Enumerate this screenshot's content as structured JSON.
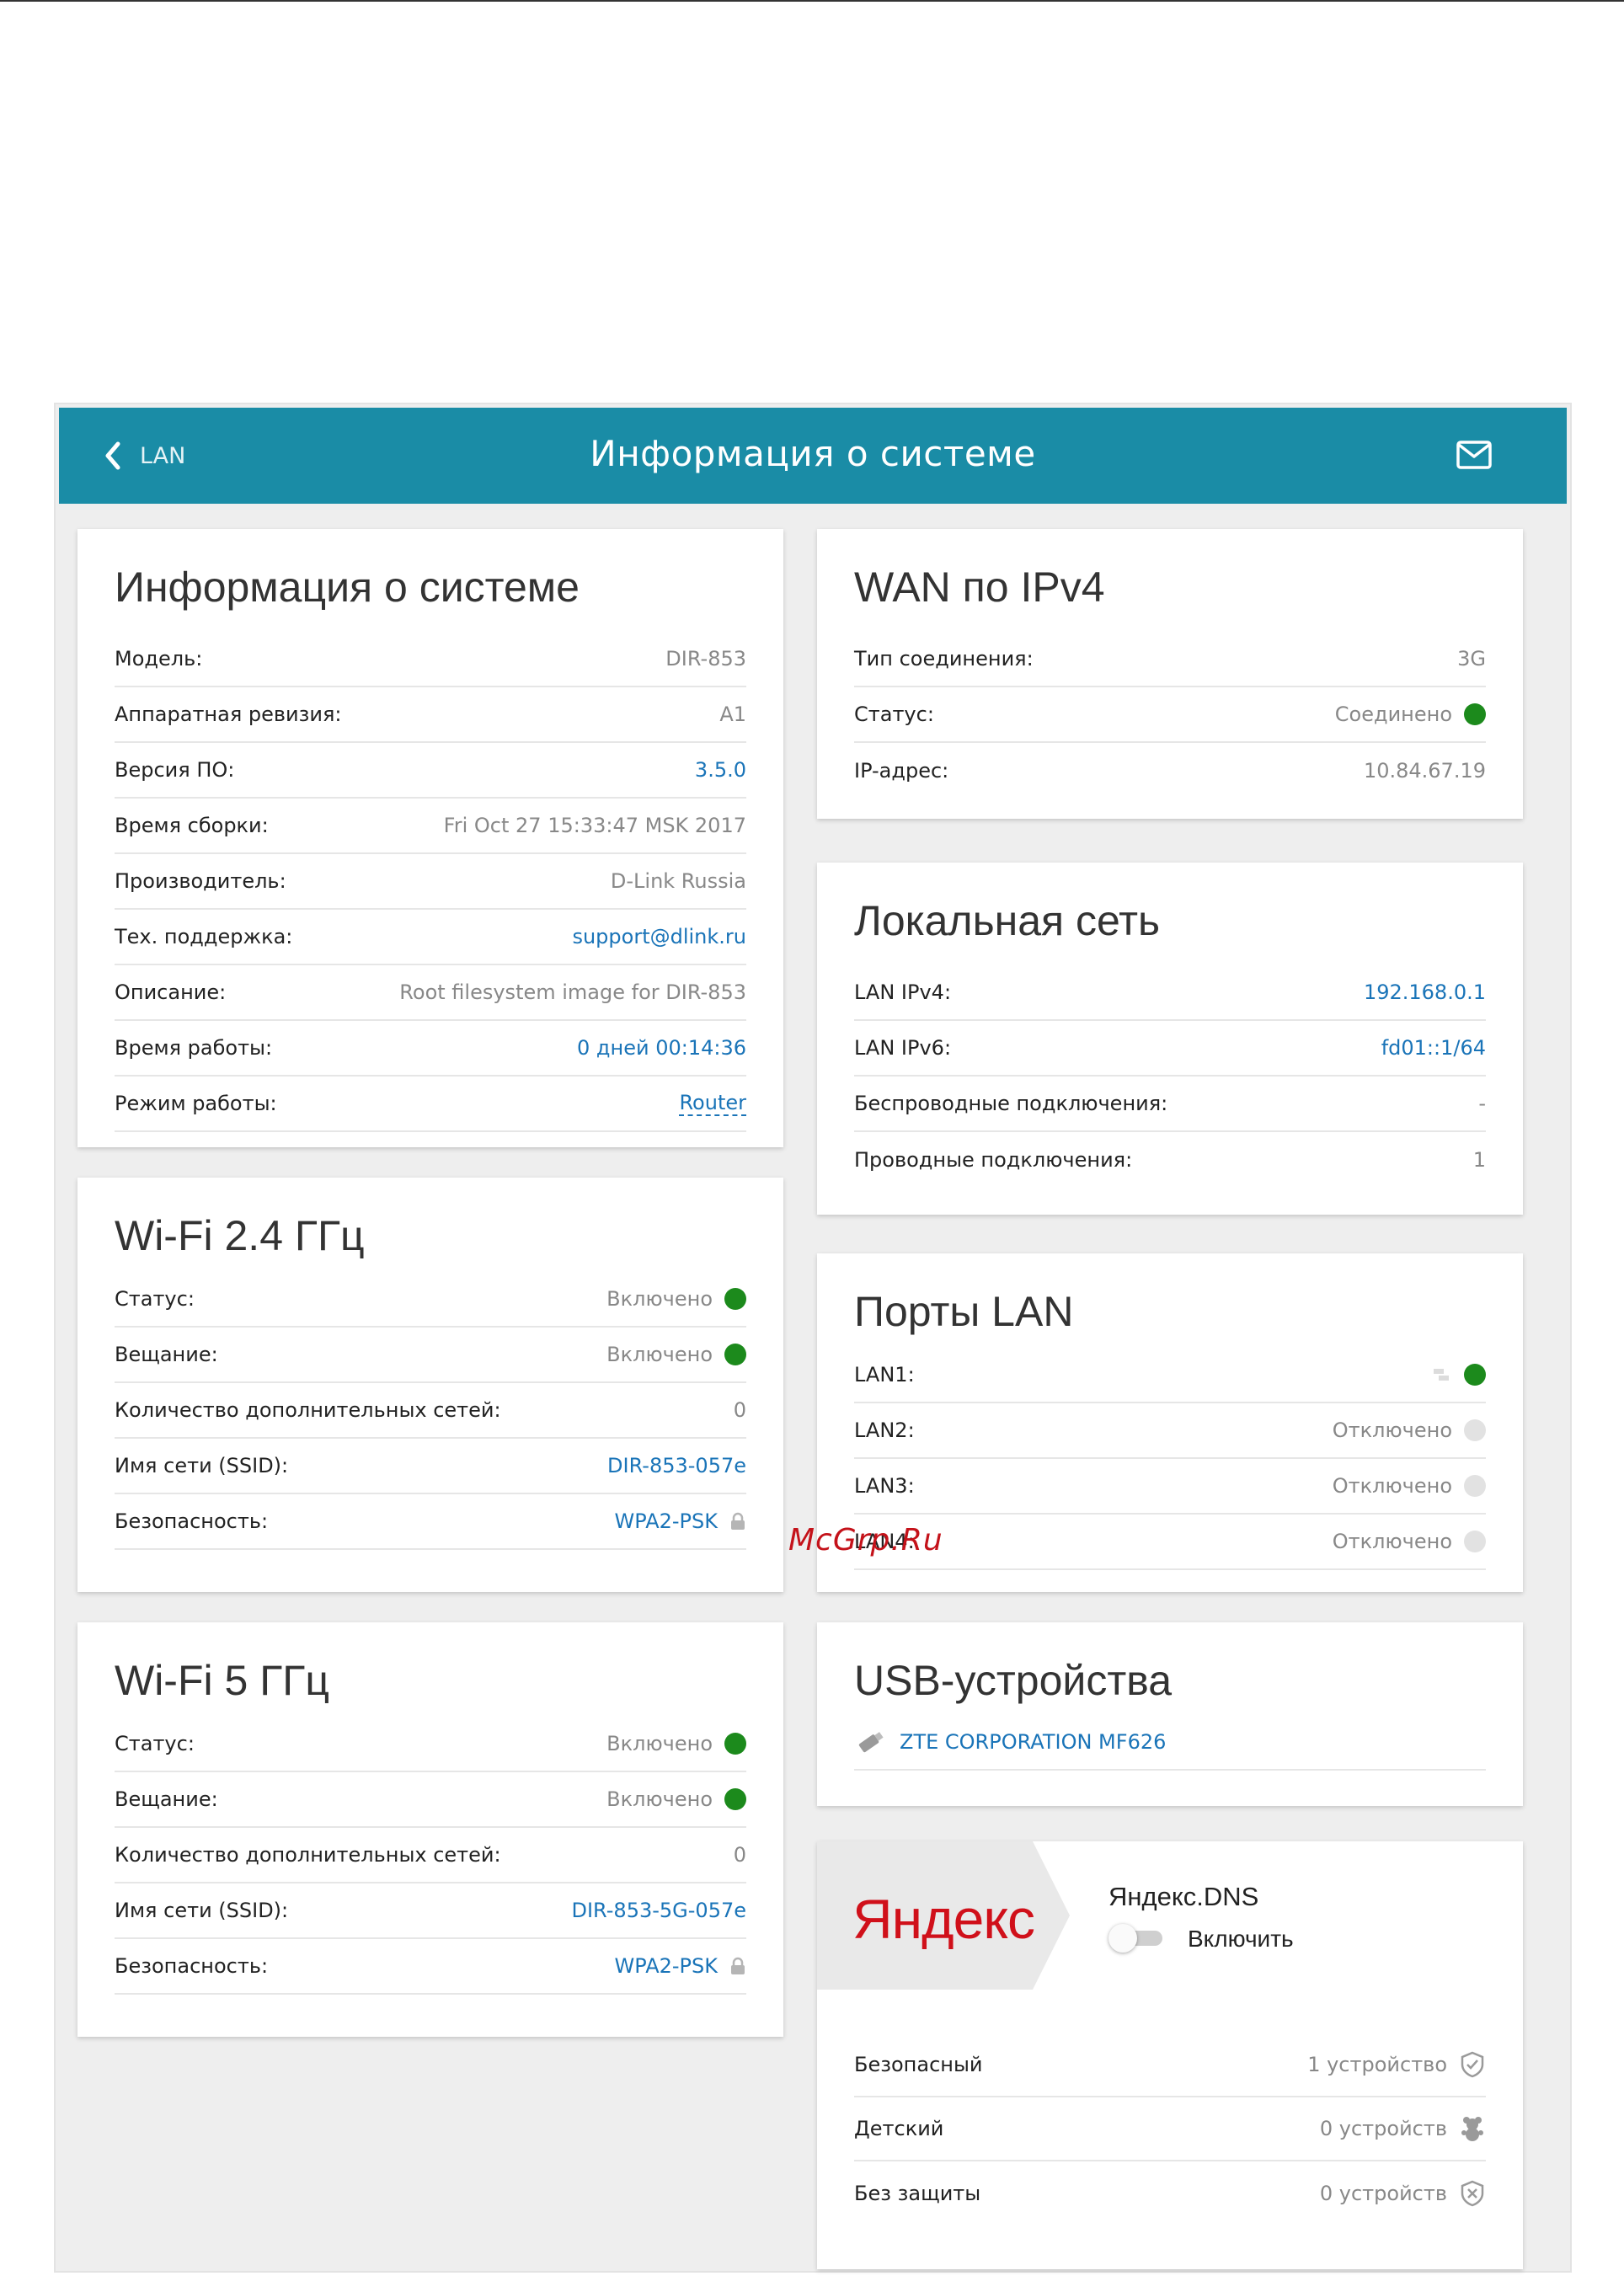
{
  "header": {
    "back_label": "LAN",
    "title": "Информация о системе"
  },
  "system_info": {
    "title": "Информация о системе",
    "rows": [
      {
        "label": "Модель:",
        "value": "DIR-853"
      },
      {
        "label": "Аппаратная ревизия:",
        "value": "A1"
      },
      {
        "label": "Версия ПО:",
        "value": "3.5.0"
      },
      {
        "label": "Время сборки:",
        "value": "Fri Oct 27 15:33:47 MSK 2017"
      },
      {
        "label": "Производитель:",
        "value": "D-Link Russia"
      },
      {
        "label": "Тех. поддержка:",
        "value": "support@dlink.ru"
      },
      {
        "label": "Описание:",
        "value": "Root filesystem image for DIR-853"
      },
      {
        "label": "Время работы:",
        "value": "0 дней 00:14:36"
      },
      {
        "label": "Режим работы:",
        "value": "Router"
      }
    ]
  },
  "wifi24": {
    "title": "Wi-Fi 2.4 ГГц",
    "rows": [
      {
        "label": "Статус:",
        "value": "Включено"
      },
      {
        "label": "Вещание:",
        "value": "Включено"
      },
      {
        "label": "Количество дополнительных сетей:",
        "value": "0"
      },
      {
        "label": "Имя сети (SSID):",
        "value": "DIR-853-057e"
      },
      {
        "label": "Безопасность:",
        "value": "WPA2-PSK"
      }
    ]
  },
  "wifi5": {
    "title": "Wi-Fi 5 ГГц",
    "rows": [
      {
        "label": "Статус:",
        "value": "Включено"
      },
      {
        "label": "Вещание:",
        "value": "Включено"
      },
      {
        "label": "Количество дополнительных сетей:",
        "value": "0"
      },
      {
        "label": "Имя сети (SSID):",
        "value": "DIR-853-5G-057e"
      },
      {
        "label": "Безопасность:",
        "value": "WPA2-PSK"
      }
    ]
  },
  "wan": {
    "title": "WAN по IPv4",
    "rows": [
      {
        "label": "Тип соединения:",
        "value": "3G"
      },
      {
        "label": "Статус:",
        "value": "Соединено"
      },
      {
        "label": "IP-адрес:",
        "value": "10.84.67.19"
      }
    ]
  },
  "lan": {
    "title": "Локальная сеть",
    "rows": [
      {
        "label": "LAN IPv4:",
        "value": "192.168.0.1"
      },
      {
        "label": "LAN IPv6:",
        "value": "fd01::1/64"
      },
      {
        "label": "Беспроводные подключения:",
        "value": "-"
      },
      {
        "label": "Проводные подключения:",
        "value": "1"
      }
    ]
  },
  "ports": {
    "title": "Порты LAN",
    "rows": [
      {
        "label": "LAN1:",
        "value": ""
      },
      {
        "label": "LAN2:",
        "value": "Отключено"
      },
      {
        "label": "LAN3:",
        "value": "Отключено"
      },
      {
        "label": "LAN4:",
        "value": "Отключено"
      }
    ]
  },
  "usb": {
    "title": "USB-устройства",
    "device": "ZTE CORPORATION MF626"
  },
  "yandex": {
    "logo": "Яндекс",
    "service_title": "Яндекс.DNS",
    "toggle_label": "Включить",
    "toggle_on": false,
    "rows": [
      {
        "label": "Безопасный",
        "value": "1 устройство"
      },
      {
        "label": "Детский",
        "value": "0 устройств"
      },
      {
        "label": "Без защиты",
        "value": "0 устройств"
      }
    ]
  },
  "watermark": "McGrp.Ru",
  "colors": {
    "header_bg": "#1a8ca6",
    "link": "#1a74b8",
    "status_on": "#1c8a1c",
    "status_off": "#e2e2e2",
    "yandex_red": "#d0101a"
  }
}
